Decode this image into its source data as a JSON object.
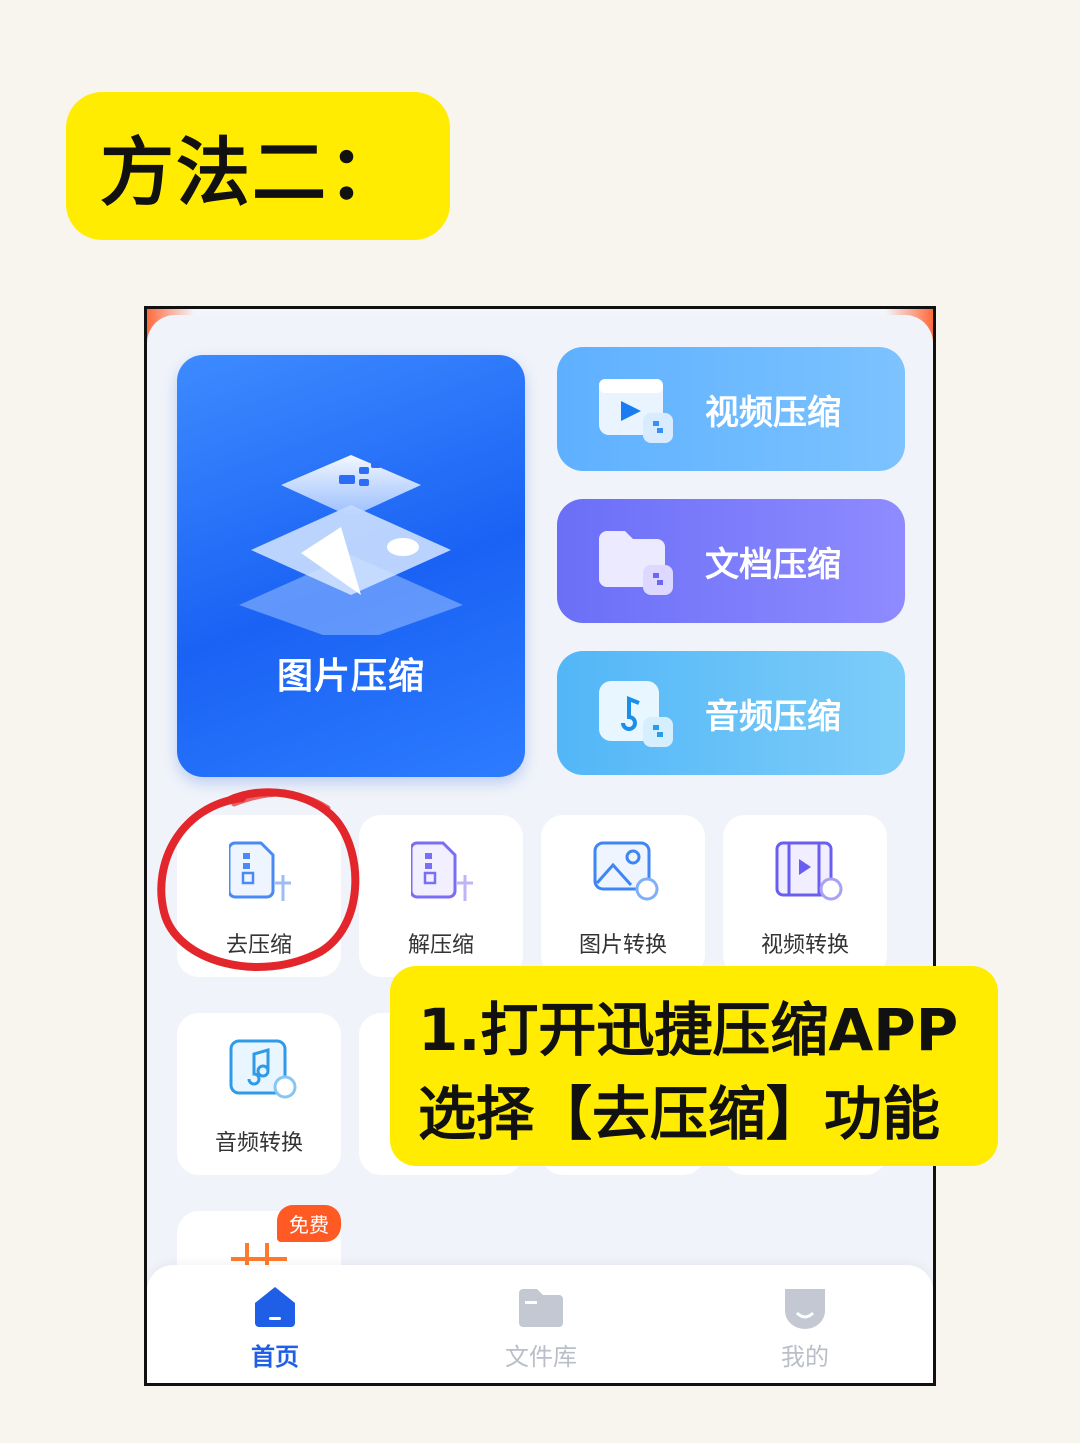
{
  "banner": {
    "title": "方法二："
  },
  "cards": {
    "image": "图片压缩",
    "video": "视频压缩",
    "doc": "文档压缩",
    "audio": "音频压缩"
  },
  "tools": [
    {
      "label": "去压缩"
    },
    {
      "label": "解压缩"
    },
    {
      "label": "图片转换"
    },
    {
      "label": "视频转换"
    },
    {
      "label": "音频转换"
    }
  ],
  "free_tool": {
    "badge": "免费"
  },
  "callout": {
    "line1": "1.打开迅捷压缩APP",
    "line2": "选择【去压缩】功能"
  },
  "nav": [
    {
      "label": "首页",
      "active": true
    },
    {
      "label": "文件库",
      "active": false
    },
    {
      "label": "我的",
      "active": false
    }
  ],
  "colors": {
    "banner_yellow": "#ffec00",
    "primary_blue": "#1a62f4",
    "nav_active": "#1f5fe8",
    "nav_inactive": "#b9bec8",
    "annotation_red": "#e3262b",
    "badge_orange": "#ff5a24"
  },
  "icons": {
    "video_card": "video-file-icon",
    "doc_card": "folder-file-icon",
    "audio_card": "music-file-icon",
    "tool_compress": "file-compress-icon",
    "tool_decompress": "file-decompress-icon",
    "tool_image_convert": "image-convert-icon",
    "tool_video_convert": "video-convert-icon",
    "tool_audio_convert": "audio-convert-icon",
    "nav_home": "home-icon",
    "nav_files": "folder-icon",
    "nav_profile": "profile-icon"
  }
}
